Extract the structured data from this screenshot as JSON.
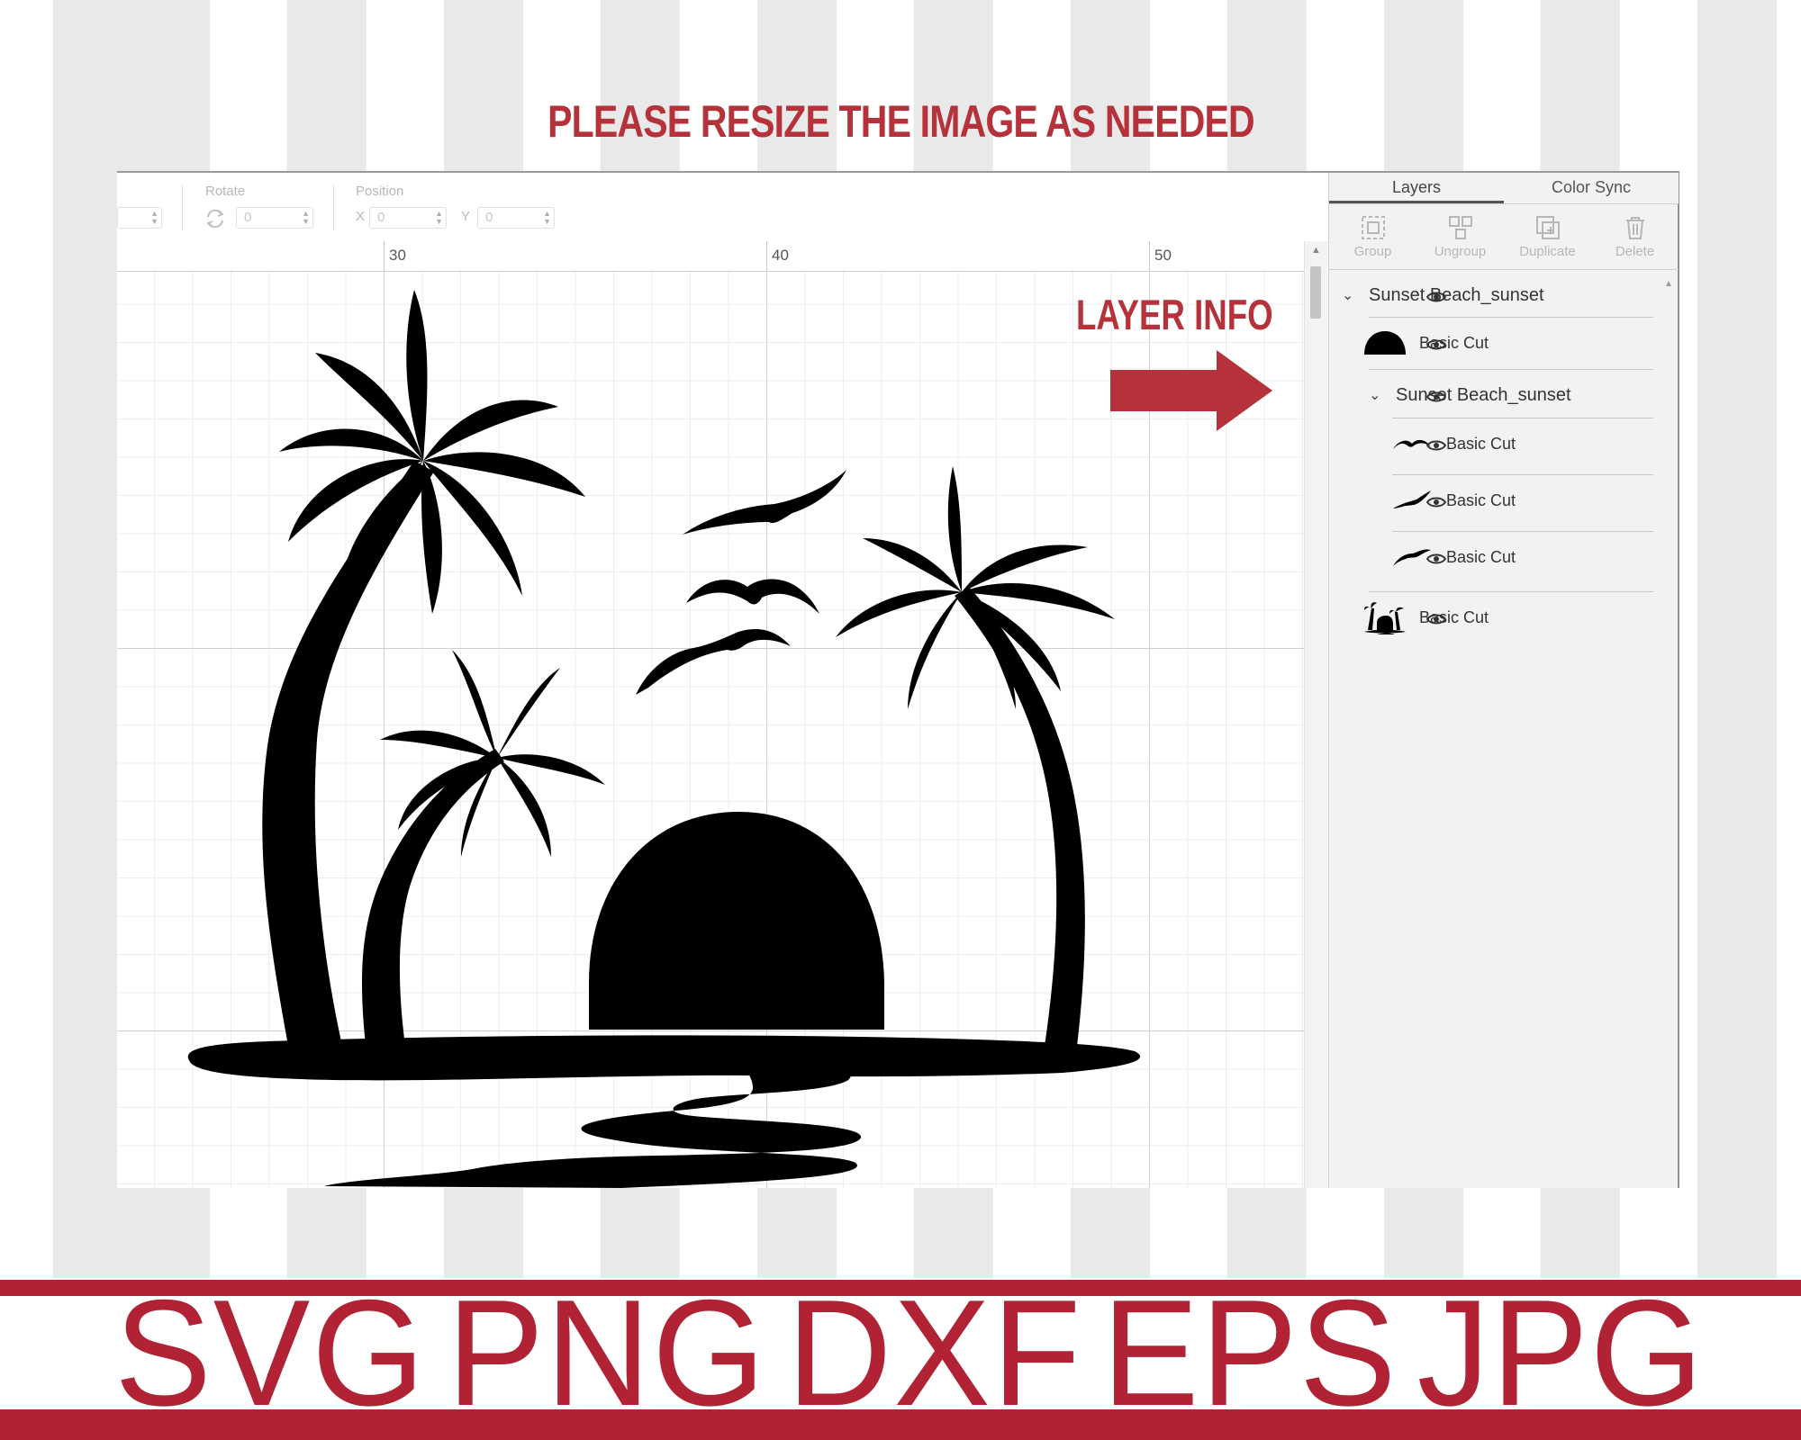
{
  "banner": {
    "text": "PLEASE RESIZE THE IMAGE AS NEEDED"
  },
  "toolbar": {
    "rotate_label": "Rotate",
    "rotate_value": "0",
    "position_label": "Position",
    "x_label": "X",
    "x_value": "0",
    "y_label": "Y",
    "y_value": "0"
  },
  "ruler": {
    "marks": [
      "30",
      "40",
      "50"
    ]
  },
  "annotation": {
    "text": "LAYER INFO"
  },
  "panel": {
    "tabs": [
      "Layers",
      "Color Sync"
    ],
    "active_tab": "Layers",
    "actions": [
      {
        "label": "Group",
        "icon": "group-icon"
      },
      {
        "label": "Ungroup",
        "icon": "ungroup-icon"
      },
      {
        "label": "Duplicate",
        "icon": "duplicate-icon"
      },
      {
        "label": "Delete",
        "icon": "trash-icon"
      }
    ],
    "layers": {
      "group1": "Sunset Beach_sunset",
      "sun": "Basic Cut",
      "group2": "Sunset Beach_sunset",
      "bird1": "Basic Cut",
      "bird2": "Basic Cut",
      "bird3": "Basic Cut",
      "palms": "Basic Cut"
    }
  },
  "formats": [
    "SVG",
    "PNG",
    "DXF",
    "EPS",
    "JPG"
  ],
  "colors": {
    "accent": "#b5323a",
    "band": "#b02234",
    "ink": "#000000"
  }
}
